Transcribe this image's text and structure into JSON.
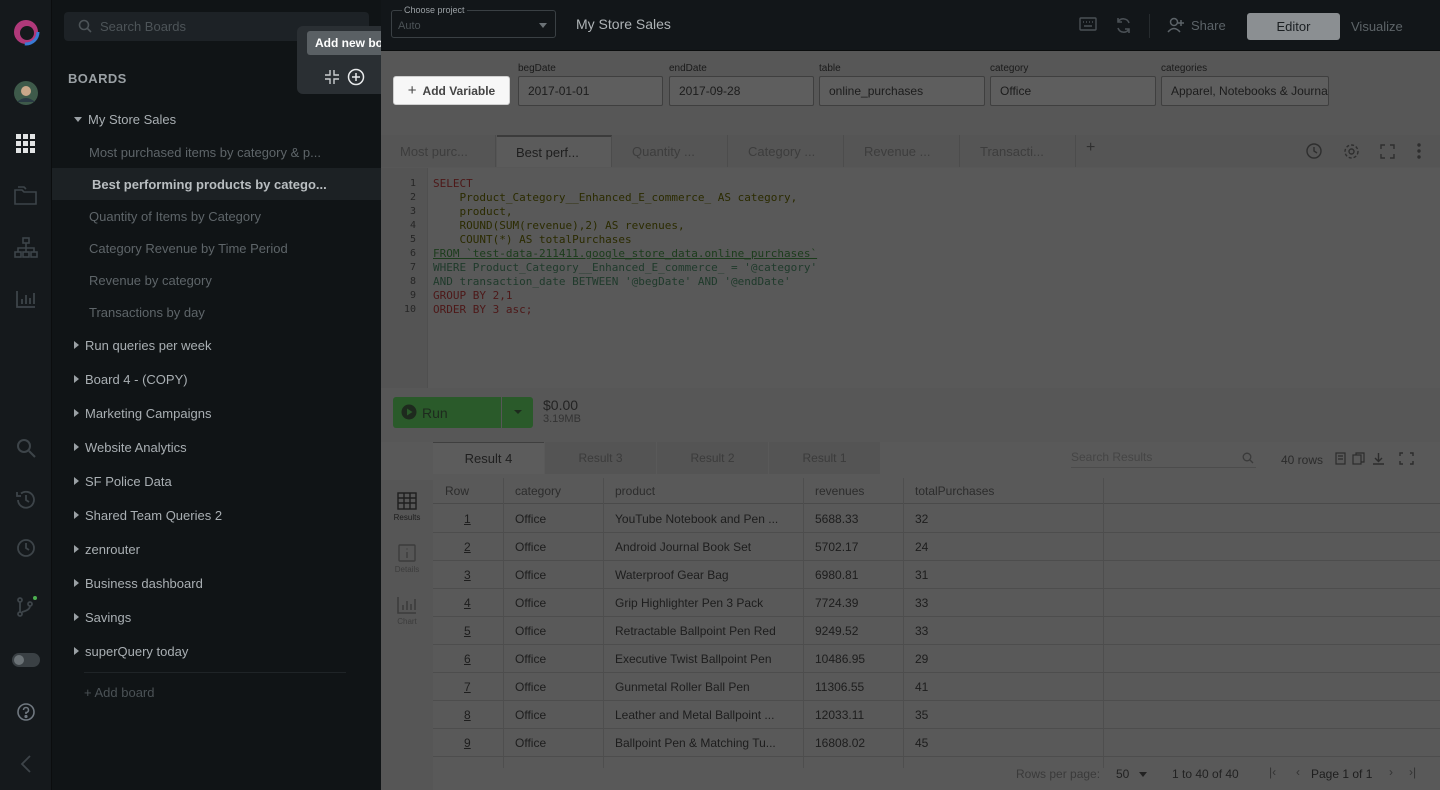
{
  "sidebar": {
    "search_placeholder": "Search Boards",
    "title": "BOARDS",
    "tooltip": "Add new board",
    "add_board": "+ Add board",
    "boards": [
      {
        "label": "My Store Sales",
        "open": true,
        "queries": [
          {
            "label": "Most purchased items by category & p...",
            "active": false
          },
          {
            "label": "Best performing products by catego...",
            "active": true
          },
          {
            "label": "Quantity of Items by Category",
            "active": false
          },
          {
            "label": "Category Revenue by Time Period",
            "active": false
          },
          {
            "label": "Revenue by category",
            "active": false
          },
          {
            "label": "Transactions by day",
            "active": false
          }
        ]
      },
      {
        "label": "Run queries per week"
      },
      {
        "label": "Board 4 - (COPY)"
      },
      {
        "label": "Marketing Campaigns"
      },
      {
        "label": "Website Analytics"
      },
      {
        "label": "SF Police Data"
      },
      {
        "label": "Shared Team Queries 2"
      },
      {
        "label": "zenrouter"
      },
      {
        "label": "Business dashboard"
      },
      {
        "label": "Savings"
      },
      {
        "label": "superQuery today"
      }
    ]
  },
  "topbar": {
    "project_label": "Choose project",
    "project_value": "Auto",
    "title": "My Store Sales",
    "share": "Share",
    "editor": "Editor",
    "visualize": "Visualize"
  },
  "variables": {
    "add_label": "Add Variable",
    "items": [
      {
        "label": "begDate",
        "value": "2017-01-01"
      },
      {
        "label": "endDate",
        "value": "2017-09-28"
      },
      {
        "label": "table",
        "value": "online_purchases"
      },
      {
        "label": "category",
        "value": "Office"
      },
      {
        "label": "categories",
        "value": "Apparel, Notebooks & Journals"
      }
    ]
  },
  "query_tabs": [
    "Most purc...",
    "Best perf...",
    "Quantity ...",
    "Category ...",
    "Revenue ...",
    "Transacti..."
  ],
  "active_tab": 1,
  "editor": {
    "line_numbers": [
      "1",
      "2",
      "3",
      "4",
      "5",
      "6",
      "7",
      "8",
      "9",
      "10"
    ],
    "lines": [
      "SELECT",
      "    Product_Category__Enhanced_E_commerce_ AS category,",
      "    product,",
      "    ROUND(SUM(revenue),2) AS revenues,",
      "    COUNT(*) AS totalPurchases",
      "FROM `test-data-211411.google_store_data.online_purchases`",
      "WHERE Product_Category__Enhanced_E_commerce_ = '@category'",
      "AND transaction_date BETWEEN '@begDate' AND '@endDate'",
      "GROUP BY 2,1",
      "ORDER BY 3 asc;"
    ]
  },
  "run": {
    "label": "Run",
    "cost": "$0.00",
    "bytes": "3.19MB"
  },
  "results": {
    "tabs": [
      "Result 4",
      "Result 3",
      "Result 2",
      "Result 1"
    ],
    "search_placeholder": "Search Results",
    "row_count": "40 rows",
    "side_tabs": [
      "Results",
      "Details",
      "Chart"
    ],
    "columns": [
      "Row",
      "category",
      "product",
      "revenues",
      "totalPurchases"
    ],
    "rows": [
      [
        "1",
        "Office",
        "YouTube Notebook and Pen ...",
        "5688.33",
        "32"
      ],
      [
        "2",
        "Office",
        "Android Journal Book Set",
        "5702.17",
        "24"
      ],
      [
        "3",
        "Office",
        "Waterproof Gear Bag",
        "6980.81",
        "31"
      ],
      [
        "4",
        "Office",
        "Grip Highlighter Pen 3 Pack",
        "7724.39",
        "33"
      ],
      [
        "5",
        "Office",
        "Retractable Ballpoint Pen Red",
        "9249.52",
        "33"
      ],
      [
        "6",
        "Office",
        "Executive Twist Ballpoint Pen",
        "10486.95",
        "29"
      ],
      [
        "7",
        "Office",
        "Gunmetal Roller Ball Pen",
        "11306.55",
        "41"
      ],
      [
        "8",
        "Office",
        "Leather and Metal Ballpoint ...",
        "12033.11",
        "35"
      ],
      [
        "9",
        "Office",
        "Ballpoint Pen & Matching Tu...",
        "16808.02",
        "45"
      ]
    ],
    "pager": {
      "rows_per_page_label": "Rows per page:",
      "rows_per_page": "50",
      "range": "1 to 40 of 40",
      "page": "Page 1 of 1"
    }
  }
}
